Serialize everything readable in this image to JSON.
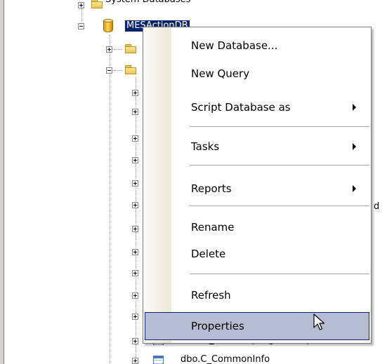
{
  "tree": {
    "top_partial_label": "System Databases",
    "database_label": "MESActionDB",
    "partial_right_text": "d",
    "bottom_table_label_1": "dbo.m_transamplingdatadeplo...",
    "bottom_table_label_2": "dbo.C_CommonInfo"
  },
  "context_menu": {
    "items": [
      {
        "label": "New Database...",
        "has_submenu": false
      },
      {
        "label": "New Query",
        "has_submenu": false
      },
      {
        "label": "Script Database as",
        "has_submenu": true
      },
      {
        "label": "Tasks",
        "has_submenu": true
      },
      {
        "label": "Reports",
        "has_submenu": true
      },
      {
        "label": "Rename",
        "has_submenu": false
      },
      {
        "label": "Delete",
        "has_submenu": false
      },
      {
        "label": "Refresh",
        "has_submenu": false
      },
      {
        "label": "Properties",
        "has_submenu": false,
        "highlighted": true
      }
    ]
  },
  "colors": {
    "selection": "#0a246a",
    "menu_highlight": "#b6bdd2",
    "menu_border": "#7a7a7a"
  },
  "icons": {
    "database": "database-icon",
    "folder": "folder-icon",
    "table": "table-icon",
    "cursor": "mouse-pointer-icon"
  }
}
